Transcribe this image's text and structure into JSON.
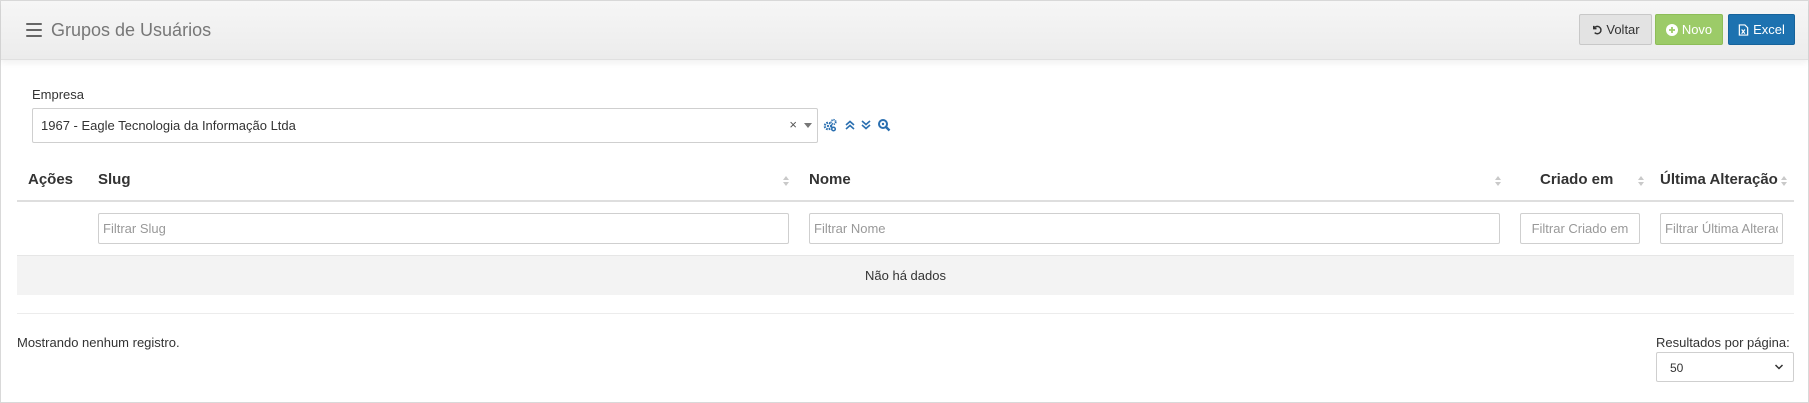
{
  "header": {
    "title": "Grupos de Usuários",
    "buttons": {
      "voltar": "Voltar",
      "novo": "Novo",
      "excel": "Excel"
    }
  },
  "filters": {
    "empresa_label": "Empresa",
    "empresa_value": "1967 - Eagle Tecnologia da Informação Ltda",
    "clear_glyph": "×"
  },
  "table": {
    "columns": [
      "Ações",
      "Slug",
      "Nome",
      "Criado em",
      "Última Alteração"
    ],
    "filter_placeholders": {
      "slug": "Filtrar Slug",
      "nome": "Filtrar Nome",
      "criado_em": "Filtrar Criado em",
      "ultima_alteracao": "Filtrar Última Alteração"
    },
    "empty_message": "Não há dados"
  },
  "footer": {
    "records_info": "Mostrando nenhum registro.",
    "page_size_label": "Resultados por página:",
    "page_size_value": "50"
  },
  "colors": {
    "novo_button": "#9ccb68",
    "excel_button": "#1d72b0",
    "icon_blue": "#2a6fb0"
  },
  "icons": [
    "menu-icon",
    "undo-icon",
    "plus-circle-icon",
    "file-excel-icon",
    "gears-icon",
    "double-chevron-up-icon",
    "double-chevron-down-icon",
    "search-icon",
    "sort-icon",
    "chevron-down-icon"
  ]
}
